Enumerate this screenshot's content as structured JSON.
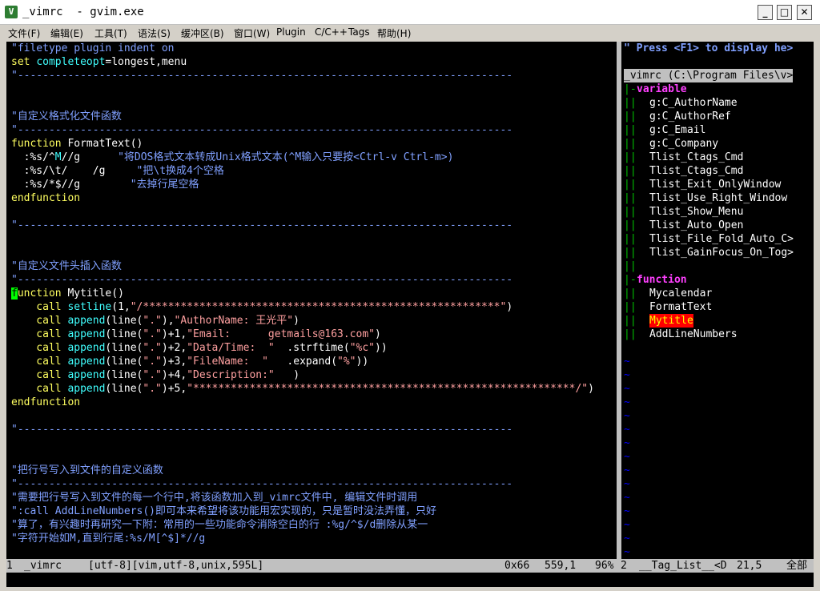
{
  "window": {
    "title": "_vimrc  - gvim.exe",
    "app_icon": "vim-icon",
    "minimize": "_",
    "maximize": "□",
    "close": "✕"
  },
  "menu": [
    "文件(F)",
    "编辑(E)",
    "工具(T)",
    "语法(S)",
    "缓冲区(B)",
    "窗口(W)",
    "Plugin",
    "C/C++",
    "Tags",
    "帮助(H)"
  ],
  "editor": {
    "l01": "\"filetype plugin indent on",
    "l02a": "set",
    "l02b": "completeopt",
    "l02c": "=",
    "l02d": "longest,menu",
    "l03": "\"-------------------------------------------------------------------------------",
    "l06": "\"自定义格式化文件函数",
    "l07": "\"-------------------------------------------------------------------------------",
    "l08a": "function",
    "l08b": " FormatText()",
    "l09a": "  :%s/^",
    "l09b": "M",
    "l09c": "//g",
    "l09d": "      \"将DOS格式文本转成Unix格式文本(^M输入只要按<Ctrl-v Ctrl-m>)",
    "l10a": "  :%s/\\t/    /g",
    "l10b": "     \"把\\t换成4个空格",
    "l11a": "  :%s/*$//g",
    "l11b": "        \"去掉行尾空格",
    "l12": "endfunction",
    "l14": "\"-------------------------------------------------------------------------------",
    "l17": "\"自定义文件头插入函数",
    "l18": "\"-------------------------------------------------------------------------------",
    "l19a": "f",
    "l19b": "unction",
    "l19c": " Mytitle()",
    "l20a": "    call",
    "l20b": " setline",
    "l20c": "(1,",
    "l20d": "\"/*********************************************************\"",
    "l20e": ")",
    "l21a": "    call",
    "l21b": " append",
    "l21c": "(line(",
    "l21d": "\".\"",
    "l21e": "),",
    "l21f": "\"AuthorName: 王光平\"",
    "l21g": ")",
    "l22a": "    call",
    "l22b": " append",
    "l22c": "(line(",
    "l22d": "\".\"",
    "l22e": ")+1,",
    "l22f": "\"Email:      getmails@163.com\"",
    "l22g": ")",
    "l23a": "    call",
    "l23b": " append",
    "l23c": "(line(",
    "l23d": "\".\"",
    "l23e": ")+2,",
    "l23f": "\"Data/Time:  \"",
    "l23g": "  .strftime(",
    "l23h": "\"%c\"",
    "l23i": "))",
    "l24a": "    call",
    "l24b": " append",
    "l24c": "(line(",
    "l24d": "\".\"",
    "l24e": ")+3,",
    "l24f": "\"FileName:  \"",
    "l24g": "   .expand(",
    "l24h": "\"%\"",
    "l24i": "))",
    "l25a": "    call",
    "l25b": " append",
    "l25c": "(line(",
    "l25d": "\".\"",
    "l25e": ")+4,",
    "l25f": "\"Description:\"",
    "l25g": "   )",
    "l26a": "    call",
    "l26b": " append",
    "l26c": "(line(",
    "l26d": "\".\"",
    "l26e": ")+5,",
    "l26f": "\"*************************************************************/\"",
    "l26g": ")",
    "l27": "endfunction",
    "l29": "\"-------------------------------------------------------------------------------",
    "l32": "\"把行号写入到文件的自定义函数",
    "l33": "\"-------------------------------------------------------------------------------",
    "l34": "\"需要把行号写入到文件的每一个行中,将该函数加入到_vimrc文件中, 编辑文件时调用",
    "l35": "\":call AddLineNumbers()即可本来希望将该功能用宏实现的，只是暂时没法弄懂，只好",
    "l36": "\"算了，有兴趣时再研究一下附：常用的一些功能命令消除空白的行 :%g/^$/d删除从某一",
    "l37": "\"字符开始如M,直到行尾:%s/M[^$]*//g"
  },
  "taglist": {
    "help": "\" Press <F1> to display he>",
    "header": "_vimrc (C:\\Program Files\\v>",
    "variable_label": "variable",
    "variables": [
      "g:C_AuthorName",
      "g:C_AuthorRef",
      "g:C_Email",
      "g:C_Company",
      "Tlist_Ctags_Cmd",
      "Tlist_Ctags_Cmd",
      "Tlist_Exit_OnlyWindow",
      "Tlist_Use_Right_Window",
      "Tlist_Show_Menu",
      "Tlist_Auto_Open",
      "Tlist_File_Fold_Auto_C>",
      "Tlist_GainFocus_On_Tog>"
    ],
    "function_label": "function",
    "functions": [
      "Mycalendar",
      "FormatText",
      "Mytitle",
      "AddLineNumbers"
    ],
    "active_function_index": 2
  },
  "status": {
    "left_num": "1",
    "left_file": "_vimrc",
    "left_info": "[utf-8][vim,utf-8,unix,595L]",
    "left_hex": "0x66",
    "left_pos": "559,1",
    "left_pct": "96%",
    "right_num": "2",
    "right_name": "__Tag_List__<D",
    "right_pos": "21,5",
    "right_pct": "全部"
  }
}
